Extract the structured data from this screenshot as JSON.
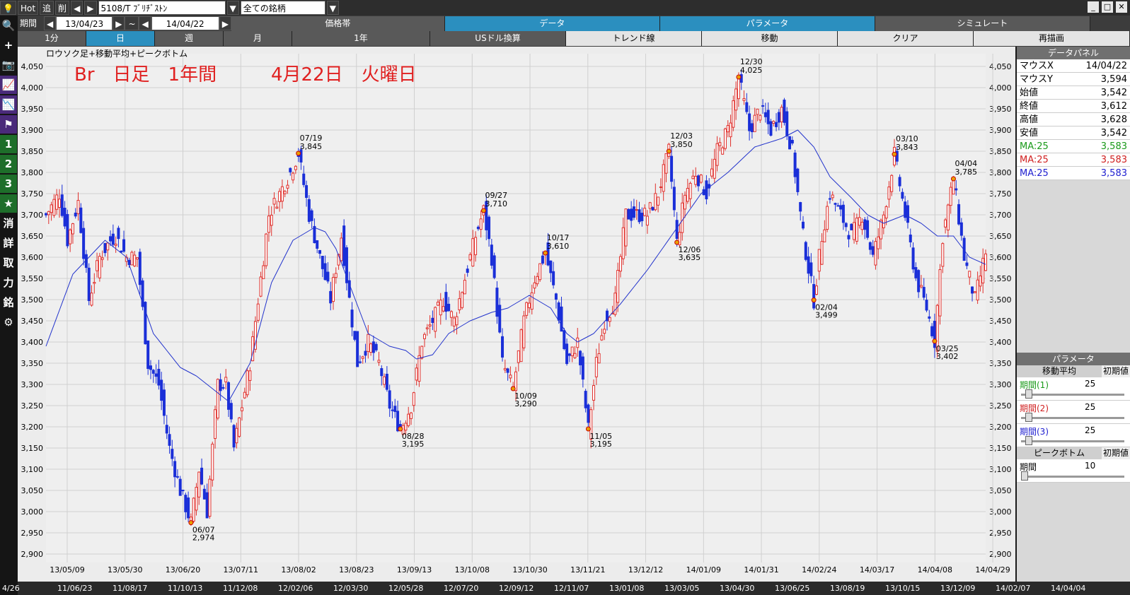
{
  "toolbar": {
    "bulb": "💡",
    "hot": "Hot",
    "add": "追",
    "del": "削",
    "symbol": "5108/T ﾌﾞﾘﾁﾞｽﾄﾝ",
    "group": "全ての銘柄",
    "term": "期間",
    "from": "13/04/23",
    "sep": "~",
    "to": "14/04/22"
  },
  "menu": {
    "top": [
      "価格帯",
      "データ",
      "パラメータ",
      "シミュレート"
    ],
    "tabs": [
      "1分",
      "日",
      "週",
      "月",
      "1年",
      "USドル換算",
      "トレンド線",
      "移動",
      "クリア",
      "再描画"
    ]
  },
  "side": [
    "🔍",
    "+",
    "📷",
    "📈",
    "📉",
    "⚑",
    "1",
    "2",
    "3",
    "★",
    "消",
    "詳",
    "取",
    "力",
    "銘",
    "⚙"
  ],
  "chart_caption": "ロウソク足+移動平均+ピークボトム",
  "title_left": "Br　日足　1年間",
  "title_right": "4月22日　火曜日",
  "colors": {
    "up": "#e0302c",
    "down": "#1a2fd8",
    "ma": "#2233cc",
    "peak": "#e8a000"
  },
  "chart_data": {
    "type": "candlestick",
    "ylim": [
      2880,
      4080
    ],
    "yticks": [
      2900,
      2950,
      3000,
      3050,
      3100,
      3150,
      3200,
      3250,
      3300,
      3350,
      3400,
      3450,
      3500,
      3550,
      3600,
      3650,
      3700,
      3750,
      3800,
      3850,
      3900,
      3950,
      4000,
      4050
    ],
    "ytick_labels": [
      "2,900",
      "2,950",
      "3,000",
      "3,050",
      "3,100",
      "3,150",
      "3,200",
      "3,250",
      "3,300",
      "3,350",
      "3,400",
      "3,450",
      "3,500",
      "3,550",
      "3,600",
      "3,650",
      "3,700",
      "3,750",
      "3,800",
      "3,850",
      "3,900",
      "3,950",
      "4,000",
      "4,050"
    ],
    "xtick_labels": [
      "13/05/09",
      "13/05/30",
      "13/06/20",
      "13/07/11",
      "13/08/02",
      "13/08/23",
      "13/09/13",
      "13/10/08",
      "13/10/30",
      "13/11/21",
      "13/12/12",
      "14/01/09",
      "14/01/31",
      "14/02/24",
      "14/03/17",
      "14/04/08",
      "14/04/29"
    ],
    "close_path": [
      [
        0,
        3700
      ],
      [
        5,
        3750
      ],
      [
        8,
        3640
      ],
      [
        12,
        3730
      ],
      [
        16,
        3500
      ],
      [
        20,
        3600
      ],
      [
        24,
        3640
      ],
      [
        26,
        3650
      ],
      [
        30,
        3600
      ],
      [
        34,
        3600
      ],
      [
        38,
        3350
      ],
      [
        42,
        3300
      ],
      [
        46,
        3150
      ],
      [
        50,
        3050
      ],
      [
        54,
        2974
      ],
      [
        57,
        3100
      ],
      [
        60,
        3000
      ],
      [
        64,
        3300
      ],
      [
        67,
        3300
      ],
      [
        70,
        3150
      ],
      [
        73,
        3250
      ],
      [
        76,
        3350
      ],
      [
        79,
        3500
      ],
      [
        83,
        3700
      ],
      [
        87,
        3750
      ],
      [
        91,
        3800
      ],
      [
        94,
        3845
      ],
      [
        98,
        3700
      ],
      [
        102,
        3600
      ],
      [
        106,
        3500
      ],
      [
        110,
        3650
      ],
      [
        113,
        3500
      ],
      [
        116,
        3350
      ],
      [
        120,
        3400
      ],
      [
        124,
        3350
      ],
      [
        128,
        3250
      ],
      [
        132,
        3195
      ],
      [
        136,
        3250
      ],
      [
        140,
        3400
      ],
      [
        144,
        3450
      ],
      [
        148,
        3500
      ],
      [
        152,
        3450
      ],
      [
        156,
        3550
      ],
      [
        160,
        3650
      ],
      [
        163,
        3710
      ],
      [
        166,
        3600
      ],
      [
        170,
        3350
      ],
      [
        174,
        3290
      ],
      [
        178,
        3450
      ],
      [
        182,
        3550
      ],
      [
        186,
        3610
      ],
      [
        190,
        3500
      ],
      [
        194,
        3350
      ],
      [
        198,
        3400
      ],
      [
        202,
        3195
      ],
      [
        205,
        3350
      ],
      [
        208,
        3450
      ],
      [
        212,
        3500
      ],
      [
        216,
        3700
      ],
      [
        220,
        3700
      ],
      [
        224,
        3700
      ],
      [
        228,
        3750
      ],
      [
        232,
        3850
      ],
      [
        235,
        3635
      ],
      [
        238,
        3750
      ],
      [
        242,
        3800
      ],
      [
        246,
        3750
      ],
      [
        250,
        3850
      ],
      [
        254,
        3900
      ],
      [
        258,
        4025
      ],
      [
        262,
        3900
      ],
      [
        266,
        3950
      ],
      [
        270,
        3900
      ],
      [
        274,
        3950
      ],
      [
        278,
        3850
      ],
      [
        282,
        3650
      ],
      [
        286,
        3499
      ],
      [
        289,
        3650
      ],
      [
        292,
        3750
      ],
      [
        296,
        3700
      ],
      [
        300,
        3650
      ],
      [
        304,
        3700
      ],
      [
        308,
        3600
      ],
      [
        312,
        3700
      ],
      [
        316,
        3843
      ],
      [
        320,
        3700
      ],
      [
        324,
        3550
      ],
      [
        328,
        3480
      ],
      [
        331,
        3402
      ],
      [
        334,
        3650
      ],
      [
        338,
        3785
      ],
      [
        342,
        3600
      ],
      [
        346,
        3500
      ],
      [
        350,
        3612
      ]
    ],
    "ma_path": [
      [
        0,
        3390
      ],
      [
        10,
        3560
      ],
      [
        22,
        3640
      ],
      [
        30,
        3600
      ],
      [
        40,
        3420
      ],
      [
        50,
        3340
      ],
      [
        56,
        3320
      ],
      [
        62,
        3290
      ],
      [
        68,
        3260
      ],
      [
        76,
        3350
      ],
      [
        84,
        3540
      ],
      [
        92,
        3640
      ],
      [
        100,
        3670
      ],
      [
        104,
        3660
      ],
      [
        108,
        3620
      ],
      [
        114,
        3520
      ],
      [
        120,
        3420
      ],
      [
        128,
        3390
      ],
      [
        134,
        3380
      ],
      [
        138,
        3360
      ],
      [
        144,
        3370
      ],
      [
        150,
        3420
      ],
      [
        158,
        3450
      ],
      [
        166,
        3470
      ],
      [
        172,
        3480
      ],
      [
        180,
        3510
      ],
      [
        188,
        3480
      ],
      [
        194,
        3420
      ],
      [
        198,
        3400
      ],
      [
        204,
        3420
      ],
      [
        214,
        3490
      ],
      [
        224,
        3570
      ],
      [
        234,
        3660
      ],
      [
        244,
        3750
      ],
      [
        254,
        3800
      ],
      [
        264,
        3860
      ],
      [
        274,
        3880
      ],
      [
        280,
        3900
      ],
      [
        286,
        3860
      ],
      [
        292,
        3790
      ],
      [
        300,
        3740
      ],
      [
        306,
        3700
      ],
      [
        312,
        3680
      ],
      [
        320,
        3700
      ],
      [
        326,
        3680
      ],
      [
        332,
        3650
      ],
      [
        338,
        3650
      ],
      [
        344,
        3600
      ],
      [
        350,
        3583
      ]
    ],
    "peaks": [
      [
        54,
        2974,
        "06/07",
        "2,974",
        "b"
      ],
      [
        94,
        3845,
        "07/19",
        "3,845",
        "t"
      ],
      [
        132,
        3195,
        "08/28",
        "3,195",
        "b"
      ],
      [
        163,
        3710,
        "09/27",
        "3,710",
        "t"
      ],
      [
        174,
        3290,
        "10/09",
        "3,290",
        "b"
      ],
      [
        186,
        3610,
        "10/17",
        "3,610",
        "t"
      ],
      [
        202,
        3195,
        "11/05",
        "3,195",
        "b"
      ],
      [
        232,
        3850,
        "12/03",
        "3,850",
        "t"
      ],
      [
        235,
        3635,
        "12/06",
        "3,635",
        "b"
      ],
      [
        258,
        4025,
        "12/30",
        "4,025",
        "t"
      ],
      [
        286,
        3499,
        "02/04",
        "3,499",
        "b"
      ],
      [
        316,
        3843,
        "03/10",
        "3,843",
        "t"
      ],
      [
        331,
        3402,
        "03/25",
        "3,402",
        "b"
      ],
      [
        338,
        3785,
        "04/04",
        "3,785",
        "t"
      ]
    ]
  },
  "bottom_dates": [
    "4/26",
    "11/06/23",
    "11/08/17",
    "11/10/13",
    "11/12/08",
    "12/02/06",
    "12/03/30",
    "12/05/28",
    "12/07/20",
    "12/09/12",
    "12/11/07",
    "13/01/08",
    "13/03/05",
    "13/04/30",
    "13/06/25",
    "13/08/19",
    "13/10/15",
    "13/12/09",
    "14/02/07",
    "14/04/04"
  ],
  "panel": {
    "title": "データパネル",
    "rows": [
      [
        "マウスX",
        "14/04/22"
      ],
      [
        "マウスY",
        "3,594"
      ],
      [
        "始値",
        "3,542"
      ],
      [
        "終値",
        "3,612"
      ],
      [
        "高値",
        "3,628"
      ],
      [
        "安値",
        "3,542"
      ]
    ],
    "ma": [
      [
        "MA:25",
        "3,583"
      ],
      [
        "MA:25",
        "3,583"
      ],
      [
        "MA:25",
        "3,583"
      ]
    ],
    "param_title": "パラメータ",
    "ma_label": "移動平均",
    "init": "初期値",
    "periods": [
      [
        "期間(1)",
        "25"
      ],
      [
        "期間(2)",
        "25"
      ],
      [
        "期間(3)",
        "25"
      ]
    ],
    "pb_label": "ピークボトム",
    "pb_init": "初期値",
    "pb_period": [
      "期間",
      "10"
    ]
  }
}
